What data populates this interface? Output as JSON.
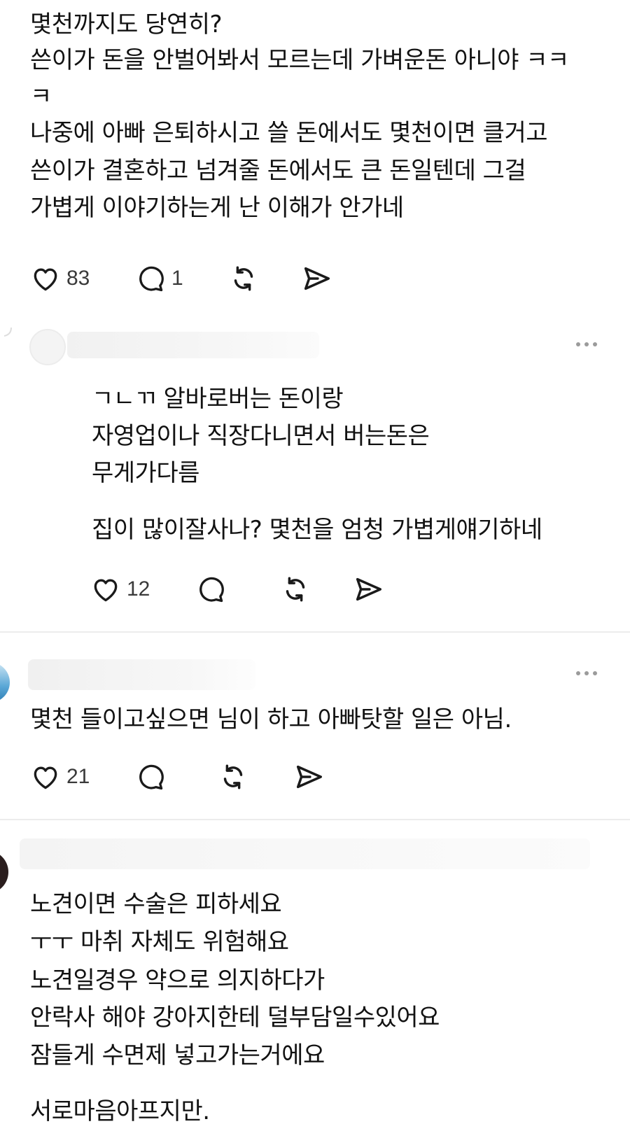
{
  "comments": [
    {
      "lines": [
        "몇천까지도 당연히?",
        "쓴이가 돈을 안벌어봐서 모르는데 가벼운돈 아니야 ㅋㅋ",
        "ㅋ",
        "나중에 아빠 은퇴하시고 쓸 돈에서도 몇천이면 클거고",
        "쓴이가 결혼하고 넘겨줄 돈에서도 큰 돈일텐데 그걸",
        "가볍게 이야기하는게 난 이해가 안가네"
      ],
      "likes": "83",
      "replies": "1"
    },
    {
      "lines": [
        "ㄱㄴㄲ 알바로버는 돈이랑",
        "자영업이나 직장다니면서 버는돈은",
        "무게가다름",
        "집이 많이잘사나? 몇천을 엄청 가볍게얘기하네"
      ],
      "likes": "12"
    },
    {
      "lines": [
        "몇천 들이고싶으면 님이 하고 아빠탓할 일은 아님."
      ],
      "likes": "21"
    },
    {
      "lines": [
        "노견이면 수술은 피하세요",
        "ㅜㅜ 마취 자체도 위험해요",
        "노견일경우 약으로 의지하다가",
        "안락사 해야 강아지한테 덜부담일수있어요",
        "잠들게 수면제 넣고가는거에요",
        "서로마음아프지만."
      ]
    }
  ],
  "icons": {
    "like": "heart-icon",
    "reply": "speech-bubble-icon",
    "repost": "repost-icon",
    "share": "send-icon",
    "more": "more-dots-icon"
  },
  "colors": {
    "text": "#121212",
    "icon": "#1a1a1a",
    "count": "#3a3a3a",
    "divider": "#ececec",
    "more_dots": "#9b9b9b"
  }
}
